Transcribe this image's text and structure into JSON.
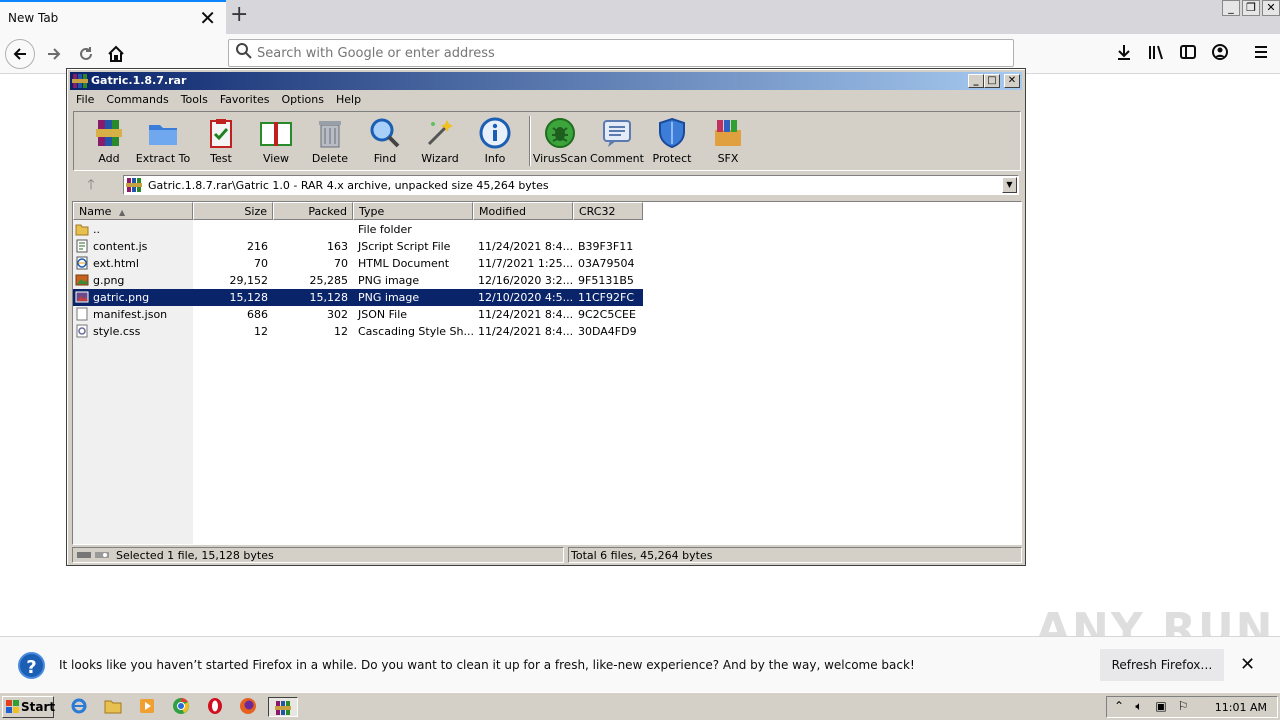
{
  "browser": {
    "tab_title": "New Tab",
    "tab_close_glyph": "✕",
    "new_tab_glyph": "+",
    "search_placeholder": "Search with Google or enter address",
    "icons": [
      "back-icon",
      "forward-icon",
      "reload-icon",
      "home-icon",
      "search-icon",
      "download-icon",
      "library-icon",
      "sidebar-icon",
      "account-icon",
      "menu-icon"
    ]
  },
  "winrar": {
    "title": "Gatric.1.8.7.rar",
    "menu": [
      "File",
      "Commands",
      "Tools",
      "Favorites",
      "Options",
      "Help"
    ],
    "toolbar": [
      "Add",
      "Extract To",
      "Test",
      "View",
      "Delete",
      "Find",
      "Wizard",
      "Info",
      "VirusScan",
      "Comment",
      "Protect",
      "SFX"
    ],
    "address": "Gatric.1.8.7.rar\\Gatric 1.0 - RAR 4.x archive, unpacked size 45,264 bytes",
    "columns": [
      "Name",
      "Size",
      "Packed",
      "Type",
      "Modified",
      "CRC32"
    ],
    "rows": [
      {
        "name": "..",
        "size": "",
        "packed": "",
        "type": "File folder",
        "modified": "",
        "crc": "",
        "icon": "folder-icon"
      },
      {
        "name": "content.js",
        "size": "216",
        "packed": "163",
        "type": "JScript Script File",
        "modified": "11/24/2021 8:4...",
        "crc": "B39F3F11",
        "icon": "script-file-icon"
      },
      {
        "name": "ext.html",
        "size": "70",
        "packed": "70",
        "type": "HTML Document",
        "modified": "11/7/2021 1:25...",
        "crc": "03A79504",
        "icon": "html-file-icon"
      },
      {
        "name": "g.png",
        "size": "29,152",
        "packed": "25,285",
        "type": "PNG image",
        "modified": "12/16/2020 3:2...",
        "crc": "9F5131B5",
        "icon": "image-file-icon"
      },
      {
        "name": "gatric.png",
        "size": "15,128",
        "packed": "15,128",
        "type": "PNG image",
        "modified": "12/10/2020 4:5...",
        "crc": "11CF92FC",
        "icon": "image-file-icon",
        "selected": true
      },
      {
        "name": "manifest.json",
        "size": "686",
        "packed": "302",
        "type": "JSON File",
        "modified": "11/24/2021 8:4...",
        "crc": "9C2C5CEE",
        "icon": "json-file-icon"
      },
      {
        "name": "style.css",
        "size": "12",
        "packed": "12",
        "type": "Cascading Style Sh...",
        "modified": "11/24/2021 8:4...",
        "crc": "30DA4FD9",
        "icon": "css-file-icon"
      }
    ],
    "status_left": "Selected 1 file, 15,128 bytes",
    "status_right": "Total 6 files, 45,264 bytes"
  },
  "notification": {
    "message": "It looks like you haven’t started Firefox in a while. Do you want to clean it up for a fresh, like-new experience? And by the way, welcome back!",
    "button": "Refresh Firefox…",
    "close_glyph": "✕"
  },
  "watermark": "ANY RUN",
  "taskbar": {
    "start_label": "Start",
    "clock": "11:01 AM"
  },
  "colors": {
    "selection": "#0a246a",
    "titlebar_start": "#0a246a",
    "titlebar_end": "#a6caf0",
    "classic_face": "#d4d0c8",
    "firefox_accent": "#0a84ff"
  }
}
